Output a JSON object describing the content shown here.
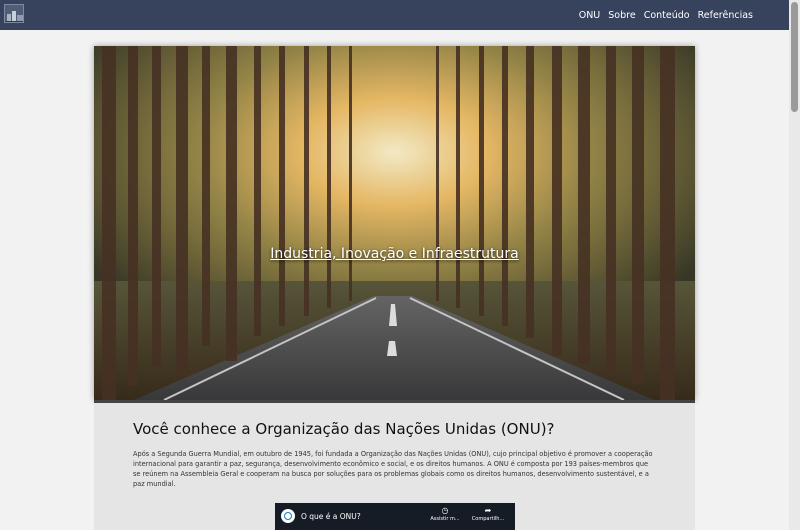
{
  "navbar": {
    "logo_icon": "site-logo-icon",
    "links": [
      "ONU",
      "Sobre",
      "Conteúdo",
      "Referências"
    ]
  },
  "hero": {
    "title": "Industria, Inovação e Infraestrutura"
  },
  "section": {
    "title": "Você conhece a Organização das Nações Unidas (ONU)?",
    "text": "Após a Segunda Guerra Mundial, em outubro de 1945, foi fundada a Organização das Nações Unidas (ONU), cujo principal objetivo é promover a cooperação internacional para garantir a paz, segurança, desenvolvimento econômico e social, e os direitos humanos. A ONU é composta por 193 países-membros que se reúnem na Assembleia Geral e cooperam na busca por soluções para os problemas globais como os direitos humanos, desenvolvimento sustentável, e a paz mundial."
  },
  "video": {
    "title": "O que é a ONU?",
    "watch_label": "Assistir m...",
    "share_label": "Compartilh...",
    "watch_icon": "clock-icon",
    "share_icon": "share-arrow-icon"
  },
  "colors": {
    "navbar": "#37435c",
    "content_bg": "#e5e5e5"
  }
}
